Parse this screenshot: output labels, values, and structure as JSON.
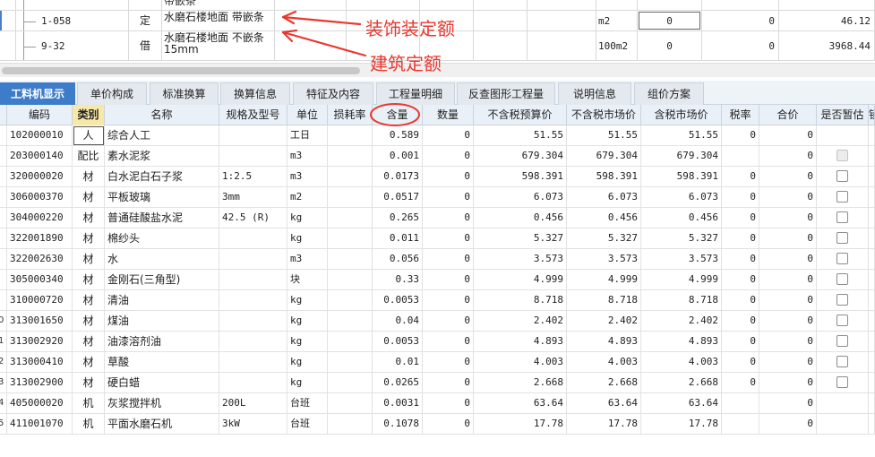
{
  "top_rows": [
    {
      "code": "",
      "type": "",
      "name": "带嵌条",
      "unit": "",
      "qty": "",
      "price": "",
      "total": ""
    },
    {
      "code": "1-058",
      "type": "定",
      "name": "水磨石楼地面 带嵌条",
      "unit": "m2",
      "qty": "0",
      "price": "0",
      "total": "46.12"
    },
    {
      "code": "9-32",
      "type": "借",
      "name": "水磨石楼地面 不嵌条 15mm",
      "unit": "100m2",
      "qty": "0",
      "price": "0",
      "total": "3968.44"
    }
  ],
  "annotations": {
    "decoration": "装饰装定额",
    "building": "建筑定额"
  },
  "annotation_color": "#e8382f",
  "tabs": [
    "工料机显示",
    "单价构成",
    "标准换算",
    "换算信息",
    "特征及内容",
    "工程量明细",
    "反查图形工程量",
    "说明信息",
    "组价方案"
  ],
  "columns": [
    "编码",
    "类别",
    "名称",
    "规格及型号",
    "单位",
    "损耗率",
    "含量",
    "数量",
    "不含税预算价",
    "不含税市场价",
    "含税市场价",
    "税率",
    "合价",
    "是否暂估",
    "锁"
  ],
  "rows": [
    {
      "lnum": "",
      "code": "102000010",
      "type": "人",
      "name": "综合人工",
      "spec": "",
      "unit": "工日",
      "loss": "",
      "content": "0.589",
      "qty": "0",
      "p1": "51.55",
      "p2": "51.55",
      "p3": "51.55",
      "tax": "0",
      "total": "0",
      "cb": "none"
    },
    {
      "lnum": "",
      "code": "203000140",
      "type": "配比",
      "name": "素水泥浆",
      "spec": "",
      "unit": "m3",
      "loss": "",
      "content": "0.001",
      "qty": "0",
      "p1": "679.304",
      "p2": "679.304",
      "p3": "679.304",
      "tax": "",
      "total": "0",
      "cb": "disabled"
    },
    {
      "lnum": "",
      "code": "320000020",
      "type": "材",
      "name": "白水泥白石子浆",
      "spec": "1:2.5",
      "unit": "m3",
      "loss": "",
      "content": "0.0173",
      "qty": "0",
      "p1": "598.391",
      "p2": "598.391",
      "p3": "598.391",
      "tax": "0",
      "total": "0",
      "cb": "box"
    },
    {
      "lnum": "",
      "code": "306000370",
      "type": "材",
      "name": "平板玻璃",
      "spec": "3mm",
      "unit": "m2",
      "loss": "",
      "content": "0.0517",
      "qty": "0",
      "p1": "6.073",
      "p2": "6.073",
      "p3": "6.073",
      "tax": "0",
      "total": "0",
      "cb": "box"
    },
    {
      "lnum": "",
      "code": "304000220",
      "type": "材",
      "name": "普通硅酸盐水泥",
      "spec": "42.5 (R)",
      "unit": "kg",
      "loss": "",
      "content": "0.265",
      "qty": "0",
      "p1": "0.456",
      "p2": "0.456",
      "p3": "0.456",
      "tax": "0",
      "total": "0",
      "cb": "box"
    },
    {
      "lnum": "",
      "code": "322001890",
      "type": "材",
      "name": "棉纱头",
      "spec": "",
      "unit": "kg",
      "loss": "",
      "content": "0.011",
      "qty": "0",
      "p1": "5.327",
      "p2": "5.327",
      "p3": "5.327",
      "tax": "0",
      "total": "0",
      "cb": "box"
    },
    {
      "lnum": "",
      "code": "322002630",
      "type": "材",
      "name": "水",
      "spec": "",
      "unit": "m3",
      "loss": "",
      "content": "0.056",
      "qty": "0",
      "p1": "3.573",
      "p2": "3.573",
      "p3": "3.573",
      "tax": "0",
      "total": "0",
      "cb": "box"
    },
    {
      "lnum": "",
      "code": "305000340",
      "type": "材",
      "name": "金刚石(三角型)",
      "spec": "",
      "unit": "块",
      "loss": "",
      "content": "0.33",
      "qty": "0",
      "p1": "4.999",
      "p2": "4.999",
      "p3": "4.999",
      "tax": "0",
      "total": "0",
      "cb": "box"
    },
    {
      "lnum": "",
      "code": "310000720",
      "type": "材",
      "name": "清油",
      "spec": "",
      "unit": "kg",
      "loss": "",
      "content": "0.0053",
      "qty": "0",
      "p1": "8.718",
      "p2": "8.718",
      "p3": "8.718",
      "tax": "0",
      "total": "0",
      "cb": "box"
    },
    {
      "lnum": "0",
      "code": "313001650",
      "type": "材",
      "name": "煤油",
      "spec": "",
      "unit": "kg",
      "loss": "",
      "content": "0.04",
      "qty": "0",
      "p1": "2.402",
      "p2": "2.402",
      "p3": "2.402",
      "tax": "0",
      "total": "0",
      "cb": "box"
    },
    {
      "lnum": "1",
      "code": "313002920",
      "type": "材",
      "name": "油漆溶剂油",
      "spec": "",
      "unit": "kg",
      "loss": "",
      "content": "0.0053",
      "qty": "0",
      "p1": "4.893",
      "p2": "4.893",
      "p3": "4.893",
      "tax": "0",
      "total": "0",
      "cb": "box"
    },
    {
      "lnum": "2",
      "code": "313000410",
      "type": "材",
      "name": "草酸",
      "spec": "",
      "unit": "kg",
      "loss": "",
      "content": "0.01",
      "qty": "0",
      "p1": "4.003",
      "p2": "4.003",
      "p3": "4.003",
      "tax": "0",
      "total": "0",
      "cb": "box"
    },
    {
      "lnum": "3",
      "code": "313002900",
      "type": "材",
      "name": "硬白蜡",
      "spec": "",
      "unit": "kg",
      "loss": "",
      "content": "0.0265",
      "qty": "0",
      "p1": "2.668",
      "p2": "2.668",
      "p3": "2.668",
      "tax": "0",
      "total": "0",
      "cb": "box"
    },
    {
      "lnum": "4",
      "code": "405000020",
      "type": "机",
      "name": "灰浆搅拌机",
      "spec": "200L",
      "unit": "台班",
      "loss": "",
      "content": "0.0031",
      "qty": "0",
      "p1": "63.64",
      "p2": "63.64",
      "p3": "63.64",
      "tax": "",
      "total": "0",
      "cb": "none"
    },
    {
      "lnum": "5",
      "code": "411001070",
      "type": "机",
      "name": "平面水磨石机",
      "spec": "3kW",
      "unit": "台班",
      "loss": "",
      "content": "0.1078",
      "qty": "0",
      "p1": "17.78",
      "p2": "17.78",
      "p3": "17.78",
      "tax": "",
      "total": "0",
      "cb": "none"
    }
  ]
}
